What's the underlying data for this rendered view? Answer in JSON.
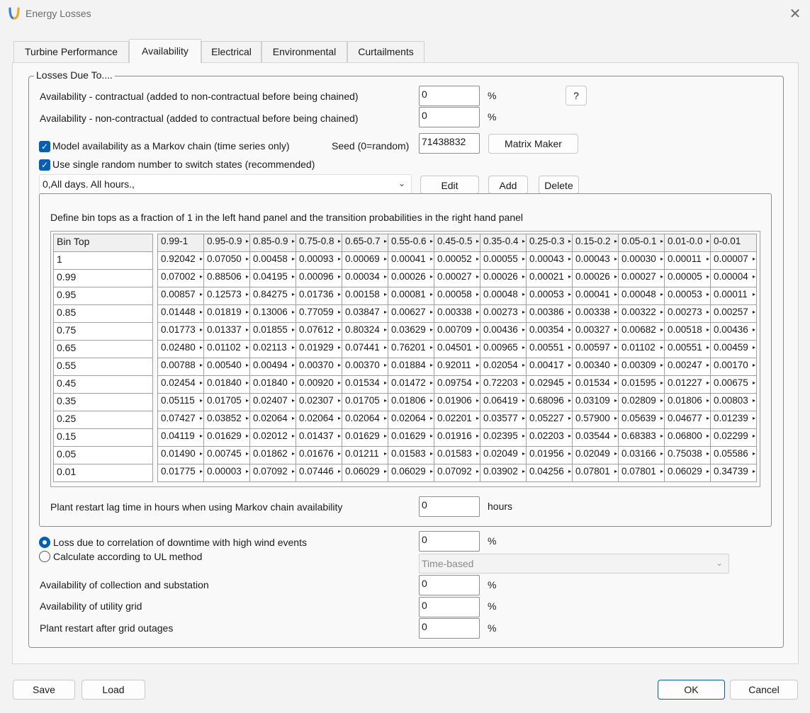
{
  "window": {
    "title": "Energy Losses",
    "close_glyph": "✕"
  },
  "tabs": [
    {
      "label": "Turbine Performance"
    },
    {
      "label": "Availability"
    },
    {
      "label": "Electrical"
    },
    {
      "label": "Environmental"
    },
    {
      "label": "Curtailments"
    }
  ],
  "group": {
    "label": "Losses Due To....",
    "availability_contractual": {
      "label": "Availability - contractual (added to non-contractual before being chained)",
      "value": "0",
      "unit": "%",
      "help_label": "?"
    },
    "availability_noncontractual": {
      "label": "Availability - non-contractual (added to contractual before being chained)",
      "value": "0",
      "unit": "%"
    },
    "markov": {
      "label": "Model availability as a Markov chain (time series only)",
      "checked": true
    },
    "seed": {
      "label": "Seed (0=random)",
      "value": "71438832"
    },
    "matrix_maker_label": "Matrix Maker",
    "single_random": {
      "label": "Use single random number to switch states (recommended)",
      "checked": true
    },
    "schedule_select": {
      "value": "0,All days. All hours.,"
    },
    "edit_label": "Edit",
    "add_label": "Add",
    "delete_label": "Delete",
    "instruction": "Define bin tops as a fraction of 1 in the left hand panel and the transition probabilities in the right hand panel",
    "bin_header": "Bin Top",
    "bin_tops": [
      "1",
      "0.99",
      "0.95",
      "0.85",
      "0.75",
      "0.65",
      "0.55",
      "0.45",
      "0.35",
      "0.25",
      "0.15",
      "0.05",
      "0.01"
    ],
    "matrix_headers": [
      "0.99-1",
      "0.95-0.9",
      "0.85-0.9",
      "0.75-0.8",
      "0.65-0.7",
      "0.55-0.6",
      "0.45-0.5",
      "0.35-0.4",
      "0.25-0.3",
      "0.15-0.2",
      "0.05-0.1",
      "0.01-0.0",
      "0-0.01"
    ],
    "matrix_rows": [
      [
        "0.92042",
        "0.07050",
        "0.00458",
        "0.00093",
        "0.00069",
        "0.00041",
        "0.00052",
        "0.00055",
        "0.00043",
        "0.00043",
        "0.00030",
        "0.00011",
        "0.00007"
      ],
      [
        "0.07002",
        "0.88506",
        "0.04195",
        "0.00096",
        "0.00034",
        "0.00026",
        "0.00027",
        "0.00026",
        "0.00021",
        "0.00026",
        "0.00027",
        "0.00005",
        "0.00004"
      ],
      [
        "0.00857",
        "0.12573",
        "0.84275",
        "0.01736",
        "0.00158",
        "0.00081",
        "0.00058",
        "0.00048",
        "0.00053",
        "0.00041",
        "0.00048",
        "0.00053",
        "0.00011"
      ],
      [
        "0.01448",
        "0.01819",
        "0.13006",
        "0.77059",
        "0.03847",
        "0.00627",
        "0.00338",
        "0.00273",
        "0.00386",
        "0.00338",
        "0.00322",
        "0.00273",
        "0.00257"
      ],
      [
        "0.01773",
        "0.01337",
        "0.01855",
        "0.07612",
        "0.80324",
        "0.03629",
        "0.00709",
        "0.00436",
        "0.00354",
        "0.00327",
        "0.00682",
        "0.00518",
        "0.00436"
      ],
      [
        "0.02480",
        "0.01102",
        "0.02113",
        "0.01929",
        "0.07441",
        "0.76201",
        "0.04501",
        "0.00965",
        "0.00551",
        "0.00597",
        "0.01102",
        "0.00551",
        "0.00459"
      ],
      [
        "0.00788",
        "0.00540",
        "0.00494",
        "0.00370",
        "0.00370",
        "0.01884",
        "0.92011",
        "0.02054",
        "0.00417",
        "0.00340",
        "0.00309",
        "0.00247",
        "0.00170"
      ],
      [
        "0.02454",
        "0.01840",
        "0.01840",
        "0.00920",
        "0.01534",
        "0.01472",
        "0.09754",
        "0.72203",
        "0.02945",
        "0.01534",
        "0.01595",
        "0.01227",
        "0.00675"
      ],
      [
        "0.05115",
        "0.01705",
        "0.02407",
        "0.02307",
        "0.01705",
        "0.01806",
        "0.01906",
        "0.06419",
        "0.68096",
        "0.03109",
        "0.02809",
        "0.01806",
        "0.00803"
      ],
      [
        "0.07427",
        "0.03852",
        "0.02064",
        "0.02064",
        "0.02064",
        "0.02064",
        "0.02201",
        "0.03577",
        "0.05227",
        "0.57900",
        "0.05639",
        "0.04677",
        "0.01239"
      ],
      [
        "0.04119",
        "0.01629",
        "0.02012",
        "0.01437",
        "0.01629",
        "0.01629",
        "0.01916",
        "0.02395",
        "0.02203",
        "0.03544",
        "0.68383",
        "0.06800",
        "0.02299"
      ],
      [
        "0.01490",
        "0.00745",
        "0.01862",
        "0.01676",
        "0.01211",
        "0.01583",
        "0.01583",
        "0.02049",
        "0.01956",
        "0.02049",
        "0.03166",
        "0.75038",
        "0.05586"
      ],
      [
        "0.01775",
        "0.00003",
        "0.07092",
        "0.07446",
        "0.06029",
        "0.06029",
        "0.07092",
        "0.03902",
        "0.04256",
        "0.07801",
        "0.07801",
        "0.06029",
        "0.34739"
      ]
    ],
    "restart_lag": {
      "label": "Plant restart lag time in hours when using Markov chain availability",
      "value": "0",
      "unit": "hours"
    },
    "high_wind": {
      "label": "Loss due to correlation of downtime with high wind events",
      "value": "0",
      "unit": "%",
      "selected": true
    },
    "ul_method": {
      "label": "Calculate according to UL method",
      "selected": false,
      "method_value": "Time-based"
    },
    "collection": {
      "label": "Availability of collection and substation",
      "value": "0",
      "unit": "%"
    },
    "utility_grid": {
      "label": "Availability of utility grid",
      "value": "0",
      "unit": "%"
    },
    "restart_grid": {
      "label": "Plant restart after grid outages",
      "value": "0",
      "unit": "%"
    }
  },
  "footer": {
    "save_label": "Save",
    "load_label": "Load",
    "ok_label": "OK",
    "cancel_label": "Cancel"
  },
  "colors": {
    "accent": "#005fb8",
    "background": "#f3f3f3",
    "panel": "#f9f9f9"
  }
}
